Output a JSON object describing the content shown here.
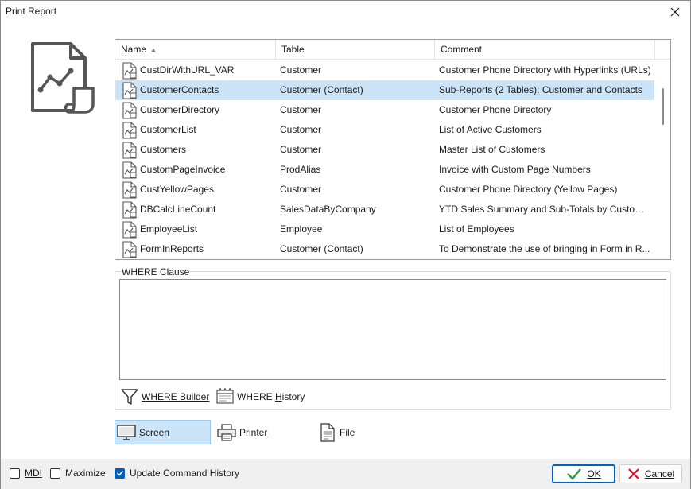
{
  "window": {
    "title": "Print Report"
  },
  "icons": {
    "close": "close-icon",
    "report_large": "report-chart-icon",
    "report_row": "report-file-icon",
    "filter": "funnel-icon",
    "history": "history-icon",
    "screen": "monitor-icon",
    "printer": "printer-icon",
    "file": "file-icon",
    "ok": "checkmark-icon",
    "cancel": "x-icon"
  },
  "colors": {
    "selection": "#cce4f7",
    "accent": "#005fb8",
    "cancel_red": "#e81123",
    "ok_green": "#2e9b3a"
  },
  "list": {
    "columns": [
      "Name",
      "Table",
      "Comment"
    ],
    "sorted_column": "Name",
    "rows": [
      {
        "name": "CustDirWithURL_VAR",
        "table": "Customer",
        "comment": "Customer Phone Directory with Hyperlinks (URLs)"
      },
      {
        "name": "CustomerContacts",
        "table": "Customer (Contact)",
        "comment": "Sub-Reports (2 Tables): Customer and Contacts"
      },
      {
        "name": "CustomerDirectory",
        "table": "Customer",
        "comment": "Customer Phone Directory"
      },
      {
        "name": "CustomerList",
        "table": "Customer",
        "comment": "List of Active Customers"
      },
      {
        "name": "Customers",
        "table": "Customer",
        "comment": "Master List of Customers"
      },
      {
        "name": "CustomPageInvoice",
        "table": "ProdAlias",
        "comment": "Invoice with Custom Page Numbers"
      },
      {
        "name": "CustYellowPages",
        "table": "Customer",
        "comment": "Customer Phone Directory (Yellow Pages)"
      },
      {
        "name": "DBCalcLineCount",
        "table": "SalesDataByCompany",
        "comment": "YTD Sales Summary and Sub-Totals by Custome..."
      },
      {
        "name": "EmployeeList",
        "table": "Employee",
        "comment": "List of Employees"
      },
      {
        "name": "FormInReports",
        "table": "Customer (Contact)",
        "comment": "To Demonstrate the use of bringing in Form in R..."
      }
    ],
    "selected_index": 1
  },
  "where": {
    "legend": "WHERE Clause",
    "value": "",
    "builder_label": "WHERE Builder",
    "history_label": "WHERE History"
  },
  "output": {
    "screen_label": "Screen",
    "printer_label": "Printer",
    "file_label": "File",
    "selected": "Screen"
  },
  "footer": {
    "mdi_label": "MDI",
    "mdi_checked": false,
    "maximize_label": "Maximize",
    "maximize_checked": false,
    "update_history_label": "Update Command History",
    "update_history_checked": true,
    "ok_label": "OK",
    "cancel_label": "Cancel"
  }
}
